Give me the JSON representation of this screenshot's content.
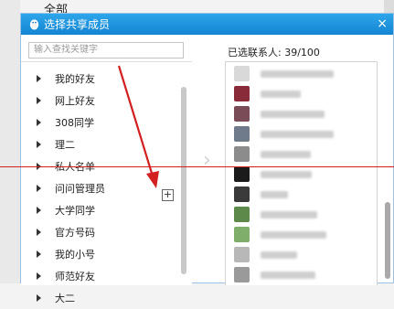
{
  "background": {
    "partial_title": "全部"
  },
  "dialog": {
    "title": "选择共享成员",
    "close_label": "×",
    "search_placeholder": "输入查找关键字",
    "groups": [
      {
        "label": "我的好友"
      },
      {
        "label": "网上好友"
      },
      {
        "label": "308同学"
      },
      {
        "label": "理二"
      },
      {
        "label": "私人名单"
      },
      {
        "label": "问问管理员"
      },
      {
        "label": "大学同学"
      },
      {
        "label": "官方号码"
      },
      {
        "label": "我的小号"
      },
      {
        "label": "师范好友"
      },
      {
        "label": "大二"
      }
    ],
    "add_button_label": "+",
    "selected_label": "已选联系人: 39/100",
    "transfer_arrow": "›",
    "contacts": [
      {
        "avatar_color": "#d9d9d9"
      },
      {
        "avatar_color": "#8a2b3a"
      },
      {
        "avatar_color": "#7a4c57"
      },
      {
        "avatar_color": "#6f7a8a"
      },
      {
        "avatar_color": "#8c8c8c"
      },
      {
        "avatar_color": "#1b1b1b"
      },
      {
        "avatar_color": "#3a3a3a"
      },
      {
        "avatar_color": "#5d8a4a"
      },
      {
        "avatar_color": "#7fae6a"
      },
      {
        "avatar_color": "#b8b8b8"
      },
      {
        "avatar_color": "#9a9a9a"
      },
      {
        "avatar_color": "#c7b9a8"
      }
    ]
  },
  "colors": {
    "titlebar": "#1e96e0",
    "annotation": "#d22020"
  }
}
